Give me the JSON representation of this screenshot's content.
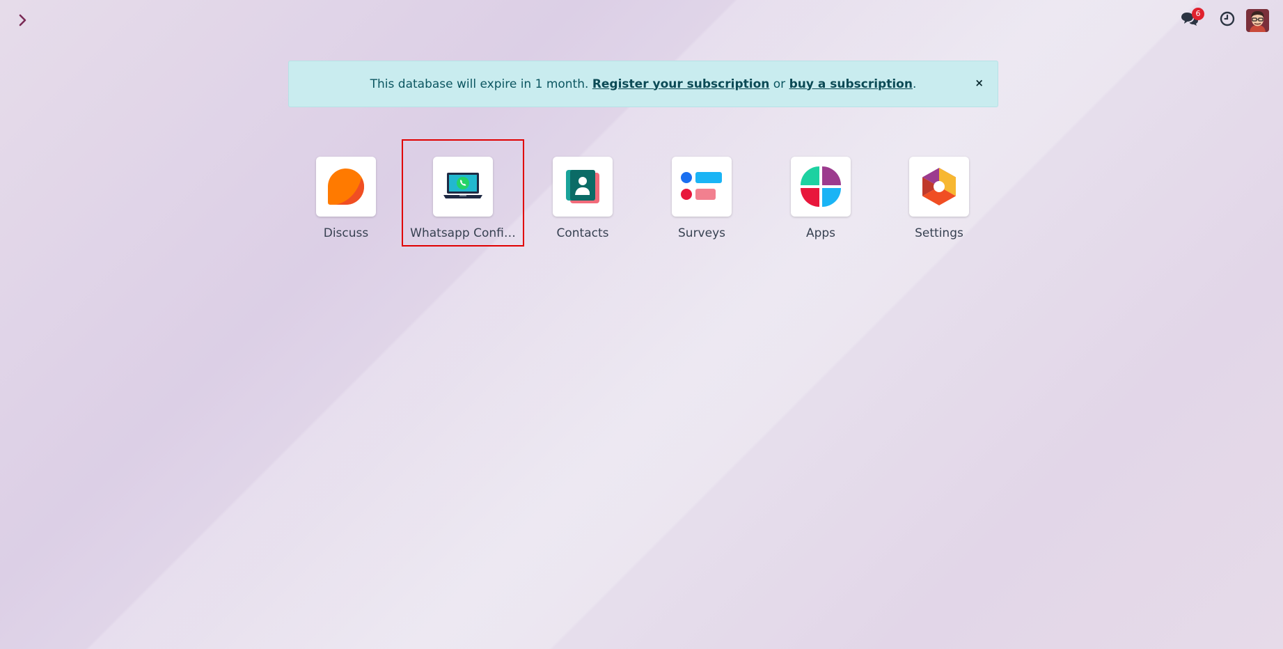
{
  "topbar": {
    "expander_icon": "chevron-right-icon",
    "messages_icon": "chat-bubbles-icon",
    "messages_count": "6",
    "activity_icon": "clock-icon",
    "avatar_icon": "user-avatar"
  },
  "banner": {
    "text_before": "This database will expire in 1 month. ",
    "register_link": "Register your subscription",
    "text_middle": " or ",
    "buy_link": "buy a subscription",
    "text_after": ".",
    "close_label": "×"
  },
  "apps": [
    {
      "label": "Discuss",
      "icon": "discuss-icon"
    },
    {
      "label": "Whatsapp Confi…",
      "icon": "whatsapp-laptop-icon",
      "selected": true
    },
    {
      "label": "Contacts",
      "icon": "contacts-icon"
    },
    {
      "label": "Surveys",
      "icon": "surveys-icon"
    },
    {
      "label": "Apps",
      "icon": "apps-icon"
    },
    {
      "label": "Settings",
      "icon": "settings-icon"
    }
  ],
  "colors": {
    "badge": "#e0212e",
    "banner_bg": "#c9ecef",
    "selection_outline": "#e00000"
  }
}
